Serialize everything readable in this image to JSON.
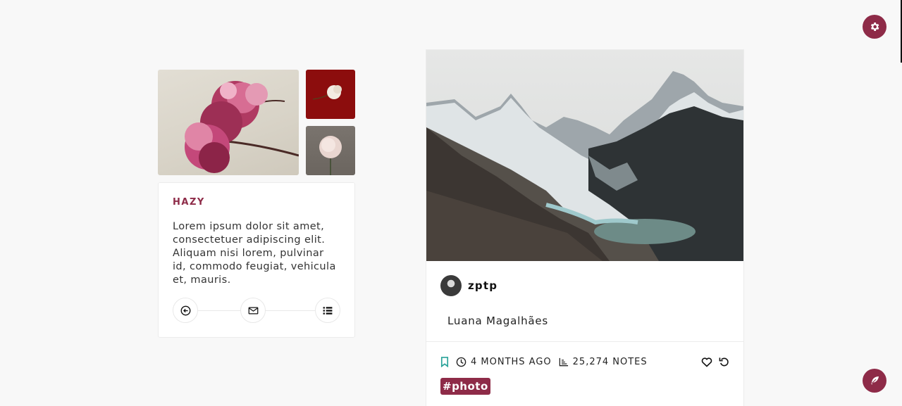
{
  "colors": {
    "accent": "#8e2b48",
    "teal": "#2aa39a",
    "background": "#f8f8f8"
  },
  "top_right": {
    "icon": "gear-icon"
  },
  "bottom_right": {
    "icon": "feather-icon"
  },
  "sidebar": {
    "title": "HAZY",
    "description": "Lorem ipsum dolor sit amet, consectetuer adipiscing elit. Aliquam nisi lorem, pulvinar id, commodo feugiat, vehicula et, mauris.",
    "actions": [
      {
        "icon": "arrow-left-circle-icon"
      },
      {
        "icon": "envelope-icon"
      },
      {
        "icon": "list-icon"
      }
    ]
  },
  "post": {
    "username": "zptp",
    "caption": "Luana Magalhães",
    "time": "4 MONTHS AGO",
    "notes": "25,274 NOTES",
    "tag": "#photo"
  }
}
